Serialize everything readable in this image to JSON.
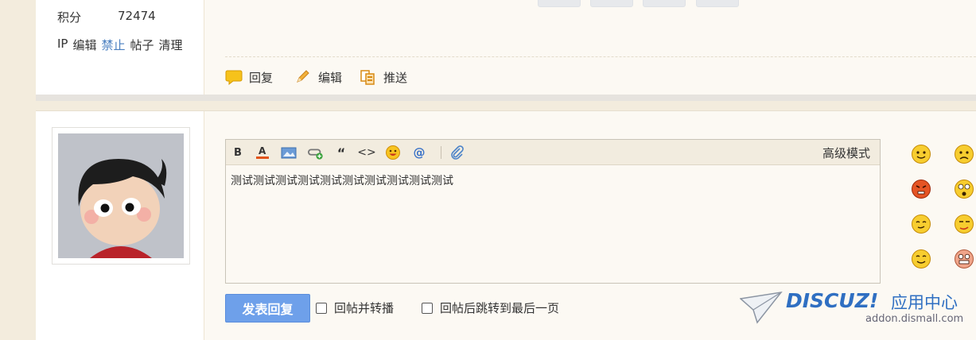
{
  "profile": {
    "points_label": "积分",
    "points_value": "72474",
    "admin_links": [
      "IP",
      "编辑",
      "禁止",
      "帖子",
      "清理"
    ]
  },
  "post_actions": {
    "reply": "回复",
    "edit": "编辑",
    "push": "推送"
  },
  "editor": {
    "advanced_mode": "高级模式",
    "content": "测试测试测试测试测试测试测试测试测试测试",
    "toolbar_bold": "B",
    "toolbar_quote": "“",
    "toolbar_code": "<>",
    "toolbar_at": "@"
  },
  "reply_form": {
    "submit_label": "发表回复",
    "option_forward": "回帖并转播",
    "option_jump_last": "回帖后跳转到最后一页"
  },
  "watermark": {
    "brand": "DISCUZ!",
    "brand_suffix": "应用中心",
    "url": "addon.dismall.com"
  },
  "colors": {
    "accent_blue": "#6ea0ea",
    "link_blue": "#4a7fc0",
    "page_bg": "#f3ecdd"
  }
}
